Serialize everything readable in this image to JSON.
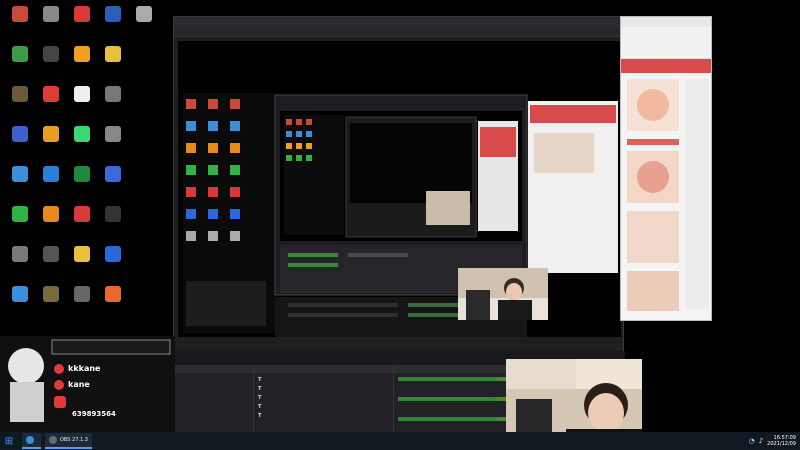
{
  "banner": {
    "text": "",
    "color": "#ff3b3b"
  },
  "desktop": {
    "icons": [
      {
        "label": "",
        "color": "#c84b3a"
      },
      {
        "label": "",
        "color": "#3d9b45"
      },
      {
        "label": "",
        "color": "#6b5a3a"
      },
      {
        "label": "",
        "color": "#3a62c8"
      },
      {
        "label": "",
        "color": "#3a8fd8"
      },
      {
        "label": "",
        "color": "#2fb344"
      },
      {
        "label": "",
        "color": "#7a7a7a"
      },
      {
        "label": "",
        "color": "#3a8fd8"
      },
      {
        "label": "",
        "color": "#888888"
      },
      {
        "label": "",
        "color": "#444444"
      },
      {
        "label": "",
        "color": "#e03a3a"
      },
      {
        "label": "",
        "color": "#e8a020"
      },
      {
        "label": "",
        "color": "#2a7fd8"
      },
      {
        "label": "",
        "color": "#e88a1a"
      },
      {
        "label": "",
        "color": "#555555"
      },
      {
        "label": "",
        "color": "#7a6a3a"
      },
      {
        "label": "",
        "color": "#d83a3a"
      },
      {
        "label": "",
        "color": "#f0a020"
      },
      {
        "label": "",
        "color": "#eeeeee"
      },
      {
        "label": "",
        "color": "#3ad870"
      },
      {
        "label": "",
        "color": "#1e8a3a"
      },
      {
        "label": "",
        "color": "#d83a3a"
      },
      {
        "label": "",
        "color": "#e8c040"
      },
      {
        "label": "",
        "color": "#666666"
      },
      {
        "label": "",
        "color": "#2a5fb8"
      },
      {
        "label": "",
        "color": "#e8c040"
      },
      {
        "label": "",
        "color": "#777777"
      },
      {
        "label": "",
        "color": "#888888"
      },
      {
        "label": "",
        "color": "#3a6ad8"
      },
      {
        "label": "",
        "color": "#333333"
      },
      {
        "label": "",
        "color": "#2a6ad8"
      },
      {
        "label": "",
        "color": "#e86a2a"
      },
      {
        "label": "",
        "color": "#aaaaaa"
      }
    ]
  },
  "obs": {
    "menu": [
      "",
      "",
      "",
      "",
      "",
      "",
      "",
      ""
    ],
    "scene_label": "",
    "panel_headers": [
      "",
      "",
      "",
      ""
    ],
    "sources": [
      "",
      "",
      "",
      "",
      ""
    ],
    "mixer": [
      "",
      "",
      ""
    ]
  },
  "overlay": {
    "name1": "kkkane",
    "name2": "kane",
    "cta": "",
    "qq": "639893564"
  },
  "taskbar": {
    "items": [
      {
        "label": "",
        "icon": "browser-icon"
      },
      {
        "label": "OBS 27.1.3",
        "icon": "obs-icon"
      }
    ],
    "time": "16:57:09",
    "date": "2021/12/09"
  }
}
